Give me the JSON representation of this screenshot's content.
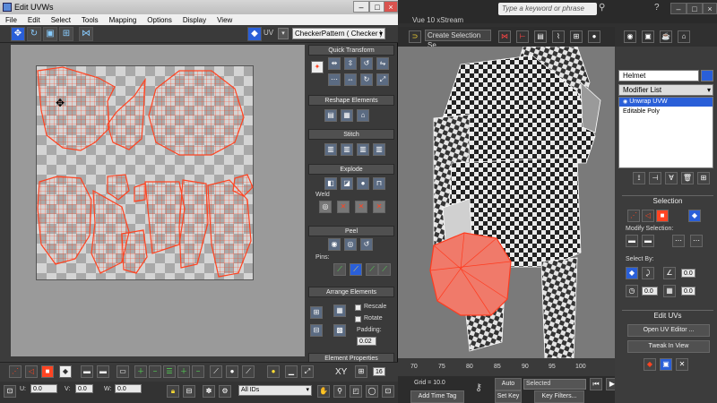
{
  "uvw_window": {
    "title": "Edit UVWs",
    "menu": [
      "File",
      "Edit",
      "Select",
      "Tools",
      "Mapping",
      "Options",
      "Display",
      "View"
    ],
    "uv_label": "UV",
    "checker_pattern": "CheckerPattern  ( Checker )"
  },
  "right_panel": {
    "quick_transform": "Quick Transform",
    "reshape_elements": "Reshape Elements",
    "stitch": "Stitch",
    "explode": "Explode",
    "weld": "Weld",
    "peel": "Peel",
    "pins": "Pins:",
    "arrange_elements": "Arrange Elements",
    "rescale": "Rescale",
    "rotate": "Rotate",
    "padding_label": "Padding:",
    "padding_value": "0.02",
    "element_properties": "Element Properties"
  },
  "uvw_bottom": {
    "u_label": "U:",
    "u_value": "0.0",
    "v_label": "V:",
    "v_value": "0.0",
    "w_label": "W:",
    "w_value": "0.0",
    "xy_label": "XY",
    "zoom_value": "16",
    "ids_select": "All IDs"
  },
  "max_app": {
    "search_placeholder": "Type a keyword or phrase",
    "vue_title": "Vue 10 xStream",
    "create_selection": "Create Selection Se",
    "timeline_ticks": [
      "70",
      "75",
      "80",
      "85",
      "90",
      "95",
      "100"
    ],
    "grid_text": "Grid = 10.0",
    "add_time_tag": "Add Time Tag",
    "auto_key": "Auto Key",
    "auto_key_value": "Selected",
    "set_key": "Set Key",
    "key_filters": "Key Filters...",
    "frame_value": "0"
  },
  "command_panel": {
    "object_name": "Helmet",
    "modifier_list": "Modifier List",
    "stack": [
      "Unwrap UVW",
      "Editable Poly"
    ],
    "selection_title": "Selection",
    "modify_selection": "Modify Selection:",
    "select_by": "Select By:",
    "threshold_value1": "0.0",
    "threshold_value2": "0.0",
    "threshold_value3": "0.0",
    "edit_uvs": "Edit UVs",
    "open_uv_editor": "Open UV Editor ...",
    "tweak_in_view": "Tweak In View"
  },
  "colors": {
    "accent_red": "#ff4422",
    "accent_blue": "#2a5fd8"
  }
}
